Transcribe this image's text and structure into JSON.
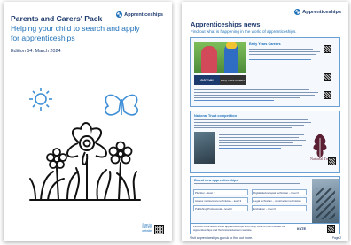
{
  "cover": {
    "logo_text": "Apprenticeships",
    "title": "Parents and Carers' Pack",
    "subtitle": "Helping your child to search and apply for apprenticeships",
    "edition": "Edition 54: March 2024",
    "qr_label": "Scan to visit the website"
  },
  "newsletter": {
    "logo_text": "Apprenticeships",
    "title": "Apprenticeships news",
    "subtitle": "Find out what is happening in the world of apprenticeships.",
    "sections": [
      {
        "heading": "Early Years Careers",
        "badge_left": "GOV.UK",
        "badge_right": "Early Years Careers"
      },
      {
        "heading": "National Trust competition",
        "partner_name": "National Trust"
      },
      {
        "heading": "Brand new apprenticeships",
        "table": [
          "Plumber – level 2",
          "Digital device repair technician – level 3",
          "Access maintenance technician – level 3",
          "Legal technician – construction technician",
          "Publishing Professional – level 3",
          "Embalmer – level 3"
        ]
      }
    ],
    "footer_text": "Find out more about these apprenticeships and many more on the Institute for Apprenticeships and Technical Education website",
    "footer_partner": "IfATE",
    "bottom_link": "Visit apprenticeships.gov.uk to find out more.",
    "page_number": "Page 2"
  },
  "colors": {
    "navy": "#1d3a6e",
    "blue": "#1d70b8",
    "light_blue_border": "#6a9fd2"
  }
}
